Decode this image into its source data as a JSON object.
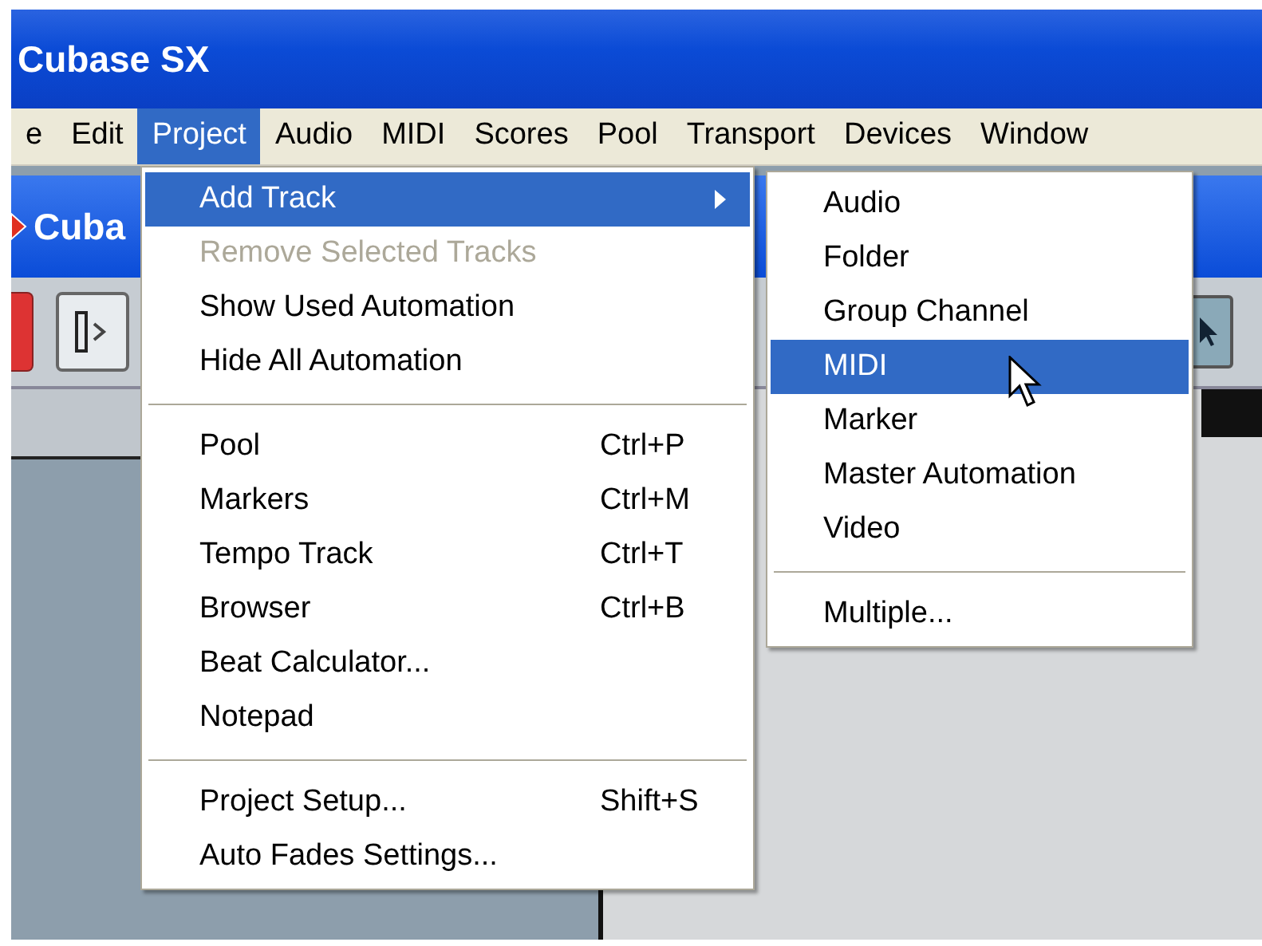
{
  "window": {
    "title": "Cubase SX"
  },
  "menubar": [
    {
      "label": "e",
      "selected": false
    },
    {
      "label": "Edit",
      "selected": false
    },
    {
      "label": "Project",
      "selected": true
    },
    {
      "label": "Audio",
      "selected": false
    },
    {
      "label": "MIDI",
      "selected": false
    },
    {
      "label": "Scores",
      "selected": false
    },
    {
      "label": "Pool",
      "selected": false
    },
    {
      "label": "Transport",
      "selected": false
    },
    {
      "label": "Devices",
      "selected": false
    },
    {
      "label": "Window",
      "selected": false
    }
  ],
  "project_window": {
    "title": "Cuba"
  },
  "project_menu": [
    {
      "kind": "item",
      "label": "Add Track",
      "selected": true,
      "disabled": false,
      "submenu": true
    },
    {
      "kind": "item",
      "label": "Remove Selected Tracks",
      "selected": false,
      "disabled": true,
      "submenu": false
    },
    {
      "kind": "item",
      "label": "Show Used Automation",
      "selected": false,
      "disabled": false,
      "submenu": false
    },
    {
      "kind": "item",
      "label": "Hide All Automation",
      "selected": false,
      "disabled": false,
      "submenu": false
    },
    {
      "kind": "separator"
    },
    {
      "kind": "item",
      "label": "Pool",
      "shortcut": "Ctrl+P",
      "selected": false,
      "disabled": false,
      "submenu": false
    },
    {
      "kind": "item",
      "label": "Markers",
      "shortcut": "Ctrl+M",
      "selected": false,
      "disabled": false,
      "submenu": false
    },
    {
      "kind": "item",
      "label": "Tempo Track",
      "shortcut": "Ctrl+T",
      "selected": false,
      "disabled": false,
      "submenu": false
    },
    {
      "kind": "item",
      "label": "Browser",
      "shortcut": "Ctrl+B",
      "selected": false,
      "disabled": false,
      "submenu": false
    },
    {
      "kind": "item",
      "label": "Beat Calculator...",
      "selected": false,
      "disabled": false,
      "submenu": false
    },
    {
      "kind": "item",
      "label": "Notepad",
      "selected": false,
      "disabled": false,
      "submenu": false
    },
    {
      "kind": "separator"
    },
    {
      "kind": "item",
      "label": "Project Setup...",
      "shortcut": "Shift+S",
      "selected": false,
      "disabled": false,
      "submenu": false
    },
    {
      "kind": "item",
      "label": "Auto Fades Settings...",
      "selected": false,
      "disabled": false,
      "submenu": false
    }
  ],
  "add_track_submenu": [
    {
      "kind": "item",
      "label": "Audio",
      "selected": false
    },
    {
      "kind": "item",
      "label": "Folder",
      "selected": false
    },
    {
      "kind": "item",
      "label": "Group Channel",
      "selected": false
    },
    {
      "kind": "item",
      "label": "MIDI",
      "selected": true
    },
    {
      "kind": "item",
      "label": "Marker",
      "selected": false
    },
    {
      "kind": "item",
      "label": "Master Automation",
      "selected": false
    },
    {
      "kind": "item",
      "label": "Video",
      "selected": false
    },
    {
      "kind": "separator"
    },
    {
      "kind": "item",
      "label": "Multiple...",
      "selected": false
    }
  ]
}
